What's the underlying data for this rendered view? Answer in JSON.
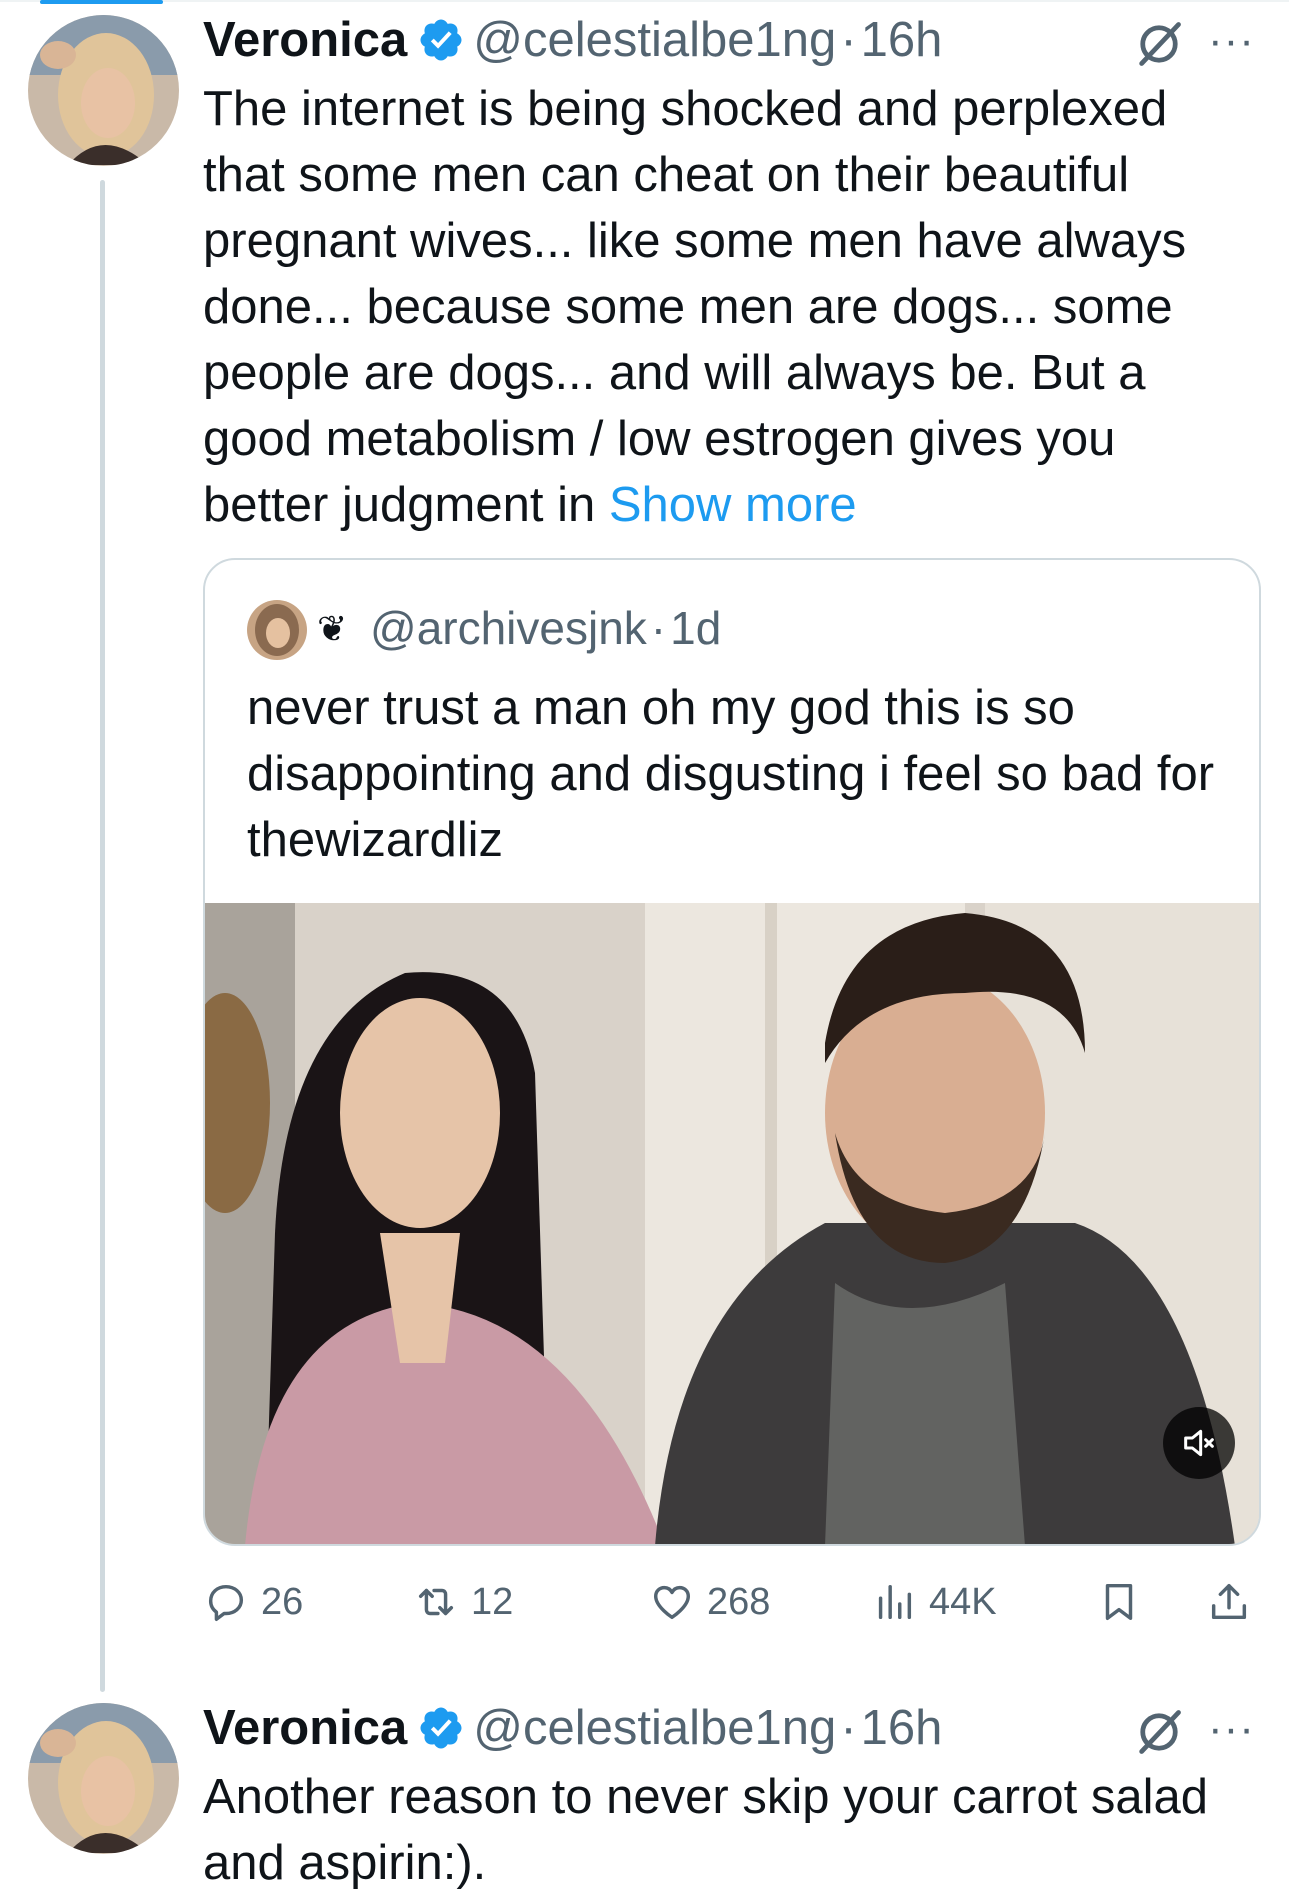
{
  "tweets": [
    {
      "name": "Veronica",
      "handle": "@celestialbe1ng",
      "separator": "·",
      "time": "16h",
      "text": "The internet is being shocked and perplexed that some men can cheat on their beautiful pregnant wives... like some men have always done... because some men are dogs... some people are dogs... and will always be. But a good metabolism / low estrogen gives you better judgment in ",
      "show_more": "Show more",
      "more_label": "···",
      "quote": {
        "heart_emoji": "❦",
        "handle": "@archivesjnk",
        "separator": "·",
        "time": "1d",
        "text": "never trust a man oh my god this is so disappointing and disgusting i feel so bad for thewizardliz"
      },
      "actions": {
        "replies": "26",
        "reposts": "12",
        "likes": "268",
        "views": "44K"
      }
    },
    {
      "name": "Veronica",
      "handle": "@celestialbe1ng",
      "separator": "·",
      "time": "16h",
      "text": "Another reason to never skip your carrot salad and aspirin:).",
      "more_label": "···"
    }
  ],
  "colors": {
    "accent": "#1d9bf0",
    "secondary_text": "#536471",
    "primary_text": "#0f1419",
    "border": "#cfd9de"
  },
  "icons": [
    "verified-badge-icon",
    "grok-icon",
    "more-icon",
    "reply-icon",
    "repost-icon",
    "like-icon",
    "views-icon",
    "bookmark-icon",
    "share-icon",
    "mute-icon"
  ]
}
